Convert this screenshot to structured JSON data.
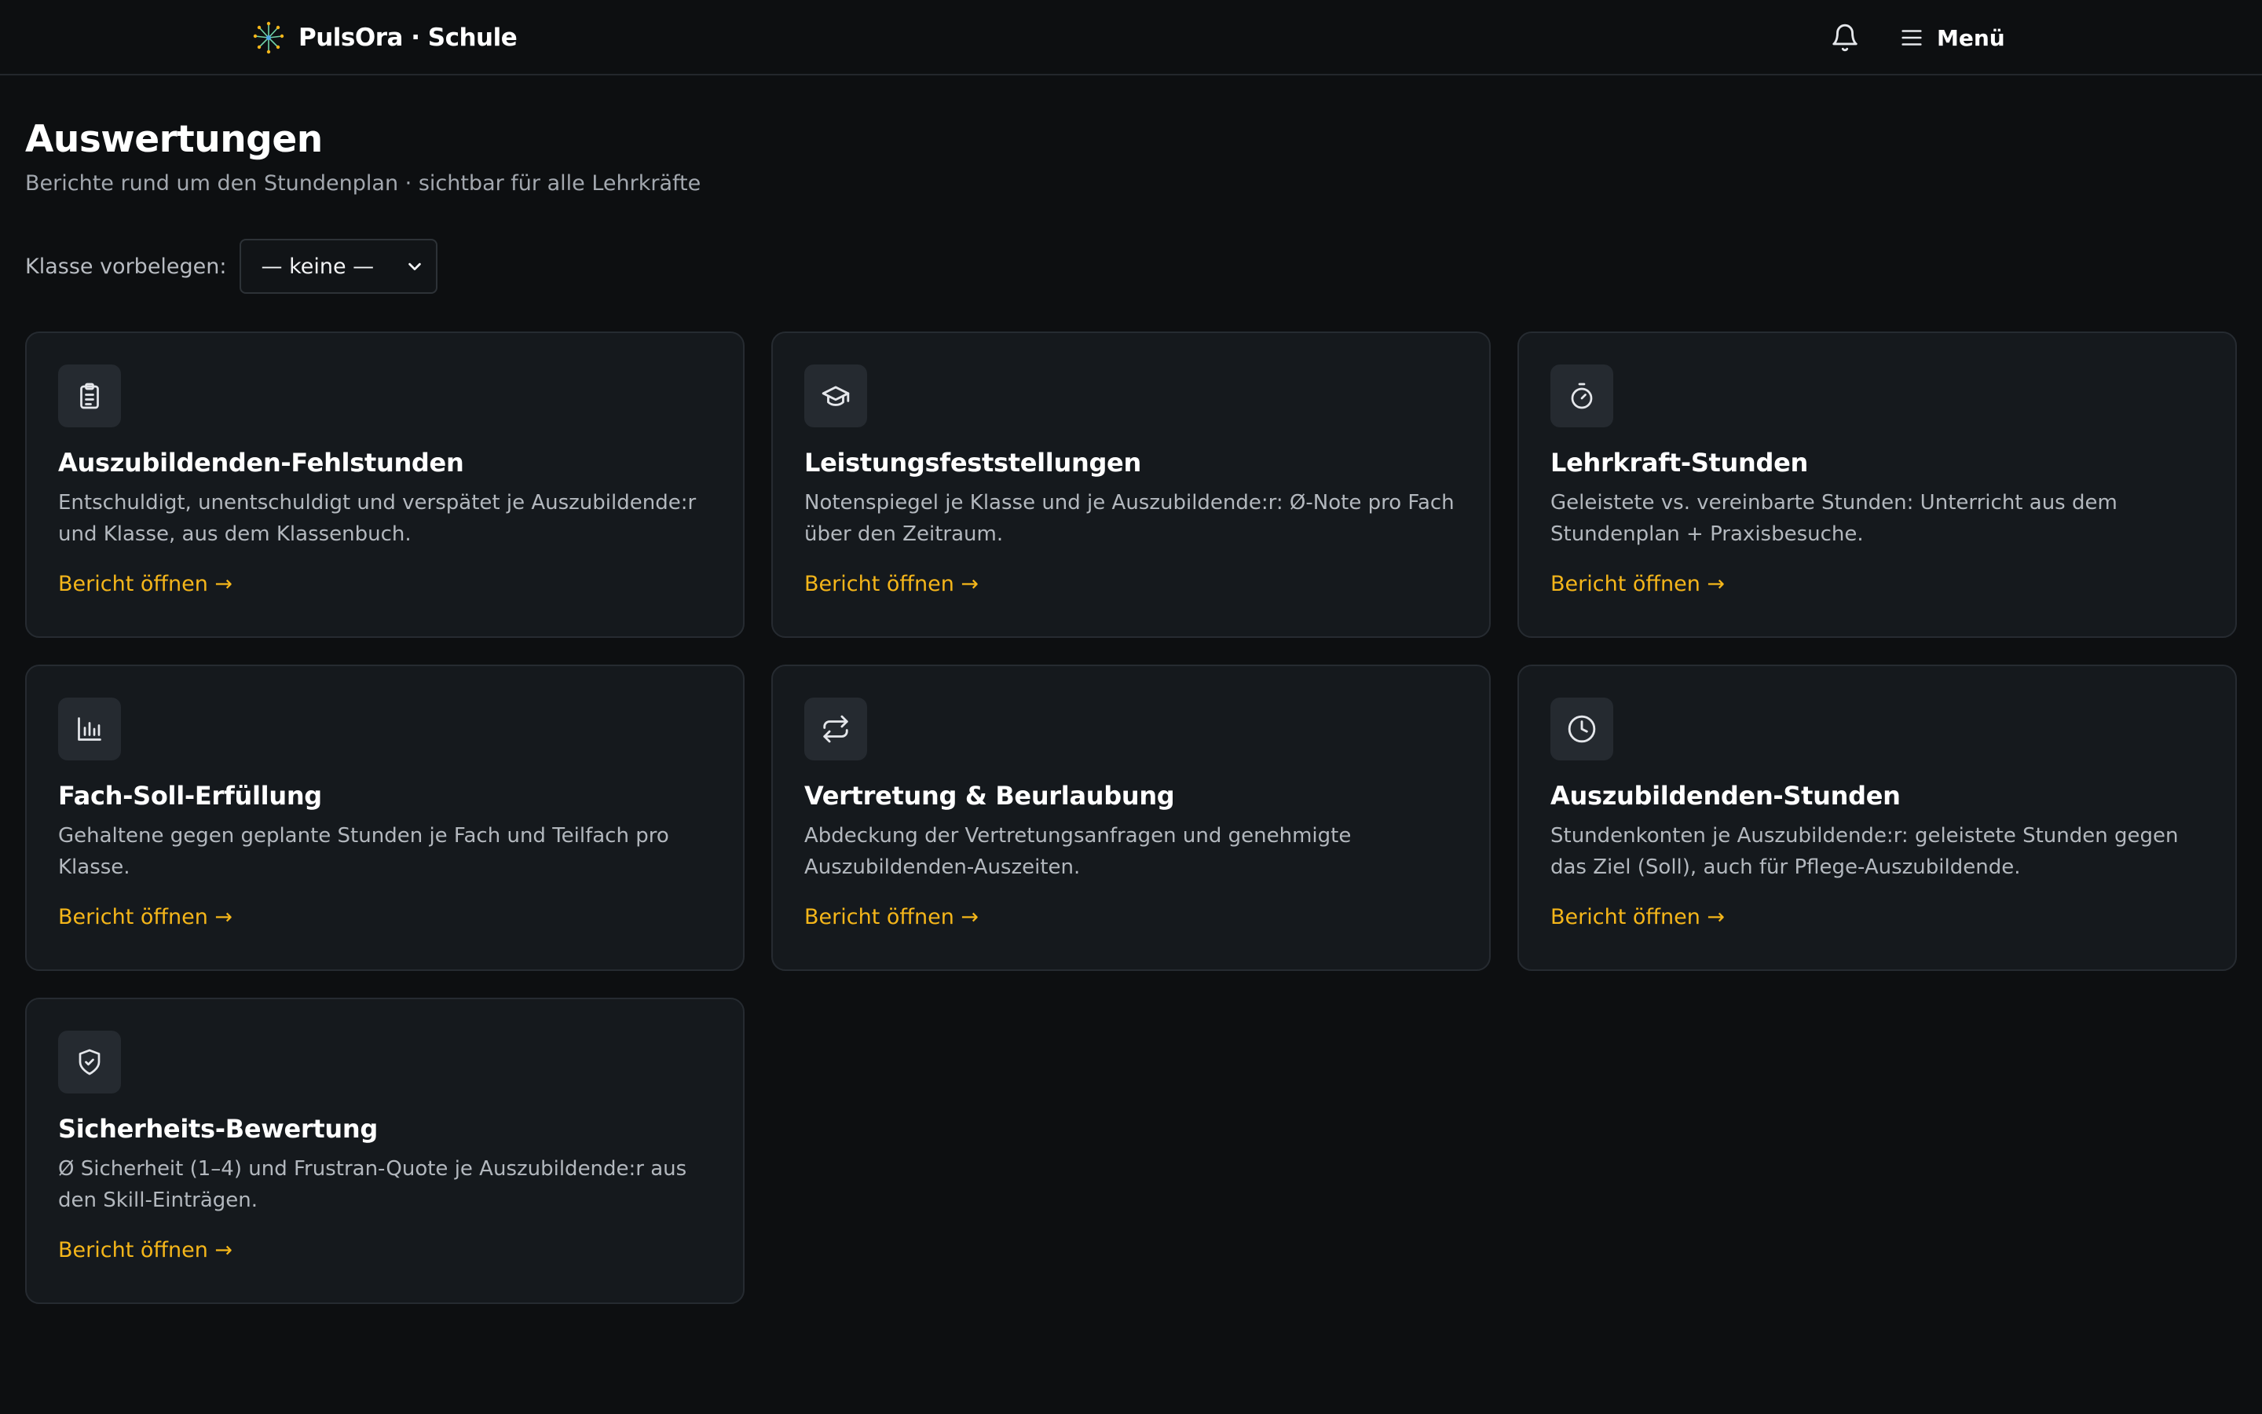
{
  "header": {
    "brand": "PulsOra · Schule",
    "menu_label": "Menü"
  },
  "page": {
    "title": "Auswertungen",
    "subtitle": "Berichte rund um den Stundenplan · sichtbar für alle Lehrkräfte"
  },
  "filter": {
    "label": "Klasse vorbelegen:",
    "selected": "— keine —"
  },
  "cards": [
    {
      "icon": "clipboard-icon",
      "title": "Auszubildenden-Fehlstunden",
      "description": "Entschuldigt, unentschuldigt und verspätet je Auszubildende:r und Klasse, aus dem Klassenbuch.",
      "link": "Bericht öffnen →"
    },
    {
      "icon": "graduation-cap-icon",
      "title": "Leistungsfeststellungen",
      "description": "Notenspiegel je Klasse und je Auszubildende:r: Ø-Note pro Fach über den Zeitraum.",
      "link": "Bericht öffnen →"
    },
    {
      "icon": "stopwatch-icon",
      "title": "Lehrkraft-Stunden",
      "description": "Geleistete vs. vereinbarte Stunden: Unterricht aus dem Stundenplan + Praxisbesuche.",
      "link": "Bericht öffnen →"
    },
    {
      "icon": "bar-chart-icon",
      "title": "Fach-Soll-Erfüllung",
      "description": "Gehaltene gegen geplante Stunden je Fach und Teilfach pro Klasse.",
      "link": "Bericht öffnen →"
    },
    {
      "icon": "swap-arrows-icon",
      "title": "Vertretung & Beurlaubung",
      "description": "Abdeckung der Vertretungsanfragen und genehmigte Auszubildenden-Auszeiten.",
      "link": "Bericht öffnen →"
    },
    {
      "icon": "clock-icon",
      "title": "Auszubildenden-Stunden",
      "description": "Stundenkonten je Auszubildende:r: geleistete Stunden gegen das Ziel (Soll), auch für Pflege-Auszubildende.",
      "link": "Bericht öffnen →"
    },
    {
      "icon": "shield-check-icon",
      "title": "Sicherheits-Bewertung",
      "description": "Ø Sicherheit (1–4) und Frustran-Quote je Auszubildende:r aus den Skill-Einträgen.",
      "link": "Bericht öffnen →"
    }
  ],
  "colors": {
    "background": "#0d0f11",
    "card": "#15191d",
    "accent": "#f5b61a",
    "text_muted": "#b3b8be"
  }
}
